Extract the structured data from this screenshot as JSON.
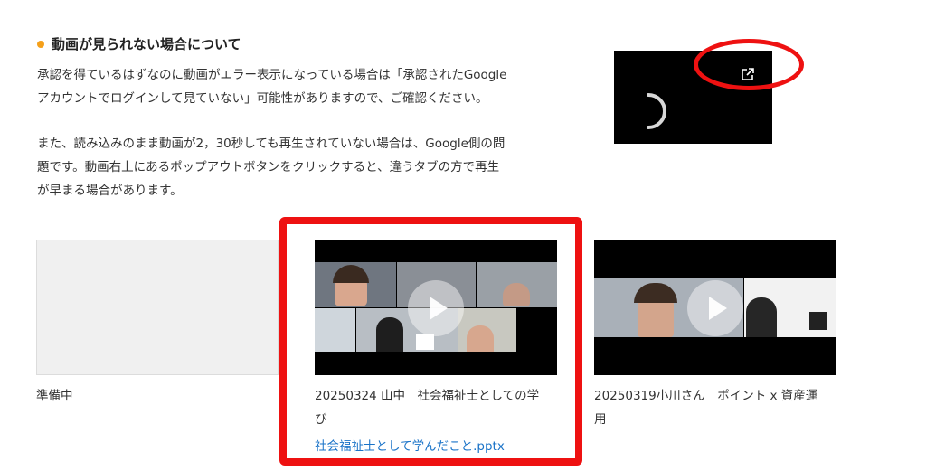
{
  "section": {
    "heading": "動画が見られない場合について",
    "paragraph1": [
      "承認を得ているはずなのに動画がエラー表示になっている場合は「承認されたGoogle",
      "アカウントでログインして見ていない」可能性がありますので、ご確認ください。"
    ],
    "paragraph2": [
      "また、読み込みのまま動画が2，30秒しても再生されていない場合は、Google側の問",
      "題です。動画右上にあるポップアウトボタンをクリックすると、違うタブの方で再生",
      "が早まる場合があります。"
    ]
  },
  "preview": {
    "spinner_icon": "loading-spinner-icon",
    "popout_icon": "popout-open-in-new-icon",
    "highlight_color": "#ee1111"
  },
  "cards": [
    {
      "title_lines": [
        "準備中"
      ],
      "state": "pending"
    },
    {
      "title_lines": [
        "20250324 山中　社会福祉士としての学",
        "び"
      ],
      "link": "社会福祉士として学んだこと.pptx",
      "state": "video",
      "highlight_color": "#ee1111"
    },
    {
      "title_lines": [
        "20250319小川さん　ポイント x 資産運",
        "用"
      ],
      "state": "video"
    }
  ],
  "colors": {
    "accent_bullet": "#f5a01a",
    "link": "#1a73c8"
  }
}
